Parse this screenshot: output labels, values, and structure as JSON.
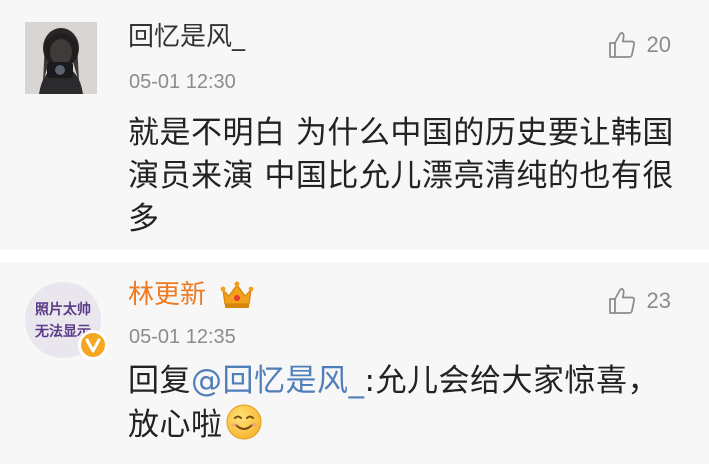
{
  "comments": [
    {
      "username": "回忆是风_",
      "time": "05-01 12:30",
      "likes": "20",
      "text": "就是不明白 为什么中国的历史要让韩国演员来演 中国比允儿漂亮清纯的也有很多"
    },
    {
      "username": "林更新",
      "time": "05-01 12:35",
      "likes": "23",
      "avatar_text_line1": "照片太帅",
      "avatar_text_line2": "无法显示",
      "reply_prefix": "回复",
      "mention": "@回忆是风_",
      "text": ":允儿会给大家惊喜，放心啦"
    }
  ],
  "colors": {
    "verified_orange": "#f5a623",
    "username_orange": "#ee7a22",
    "mention_blue": "#4f7eb8",
    "background": "#f7f7f7"
  },
  "icons": {
    "like": "thumbs-up-icon",
    "vip": "crown-icon",
    "verified": "verified-v-icon",
    "emoji": "smile-emoji-icon"
  }
}
